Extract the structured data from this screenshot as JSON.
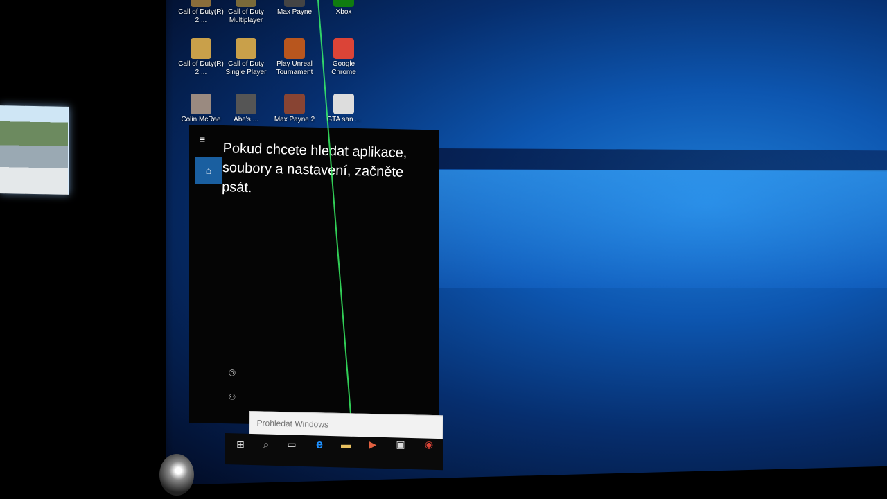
{
  "desktop_icons": [
    {
      "label": "Call of Duty(R) 2 ...",
      "icon": "cod2-icon",
      "color": "#8a6d3b"
    },
    {
      "label": "Call of Duty Multiplayer",
      "icon": "cod-mp-icon",
      "color": "#7a6a3a"
    },
    {
      "label": "Max Payne",
      "icon": "max-payne-icon",
      "color": "#444"
    },
    {
      "label": "Xbox",
      "icon": "xbox-icon",
      "color": "#107c10"
    },
    {
      "label": "Call of Duty(R) 2 ...",
      "icon": "cod2-star-icon",
      "color": "#c9a04a"
    },
    {
      "label": "Call of Duty Single Player",
      "icon": "cod-sp-icon",
      "color": "#c9a04a"
    },
    {
      "label": "Play Unreal Tournament",
      "icon": "unreal-icon",
      "color": "#b8561e"
    },
    {
      "label": "Google Chrome",
      "icon": "chrome-icon",
      "color": "#db4437"
    },
    {
      "label": "Colin McRae ...",
      "icon": "colin-mcrae-icon",
      "color": "#9a8a80"
    },
    {
      "label": "Abe's ...",
      "icon": "abes-icon",
      "color": "#555"
    },
    {
      "label": "Max Payne 2 ...",
      "icon": "max-payne2-icon",
      "color": "#884433"
    },
    {
      "label": "GTA san ...",
      "icon": "gta-icon",
      "color": "#dddddd"
    }
  ],
  "start": {
    "menu_icon": "≡",
    "home_icon": "⌂",
    "prompt": "Pokud chcete hledat aplikace, soubory a nastavení, začněte psát.",
    "settings_icon": "◎",
    "user_icon": "⚇"
  },
  "search": {
    "placeholder": "Prohledat Windows"
  },
  "taskbar": {
    "start_icon": "⊞",
    "search_icon": "⌕",
    "taskview_icon": "▭",
    "edge_icon": "e",
    "explorer_icon": "▬",
    "media_icon": "▶",
    "store_icon": "▣",
    "chrome_icon": "◉"
  },
  "colors": {
    "accent": "#1a5fa0",
    "wallpaper": "#0d56b0"
  }
}
